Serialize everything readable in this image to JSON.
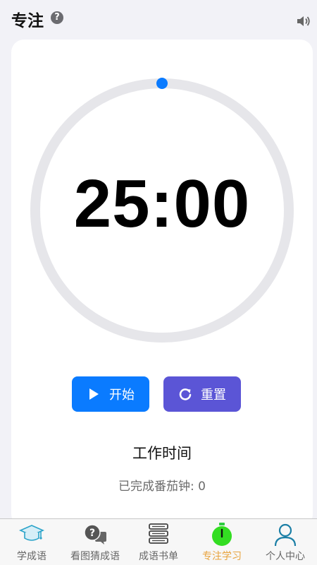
{
  "header": {
    "title": "专注",
    "help_glyph": "?",
    "icons": [
      "help-icon",
      "speaker-icon"
    ]
  },
  "timer": {
    "display": "25:00",
    "progress": 0,
    "ring_color": "#e6e6ea",
    "indicator_color": "#0a7bff"
  },
  "controls": {
    "start_label": "开始",
    "reset_label": "重置",
    "start_color": "#0a7bff",
    "reset_color": "#5b55d6"
  },
  "status": {
    "mode": "工作时间",
    "completed_text": "已完成番茄钟: 0"
  },
  "tabbar": {
    "items": [
      {
        "label": "学成语",
        "icon": "graduation-cap-icon",
        "active": false
      },
      {
        "label": "看图猜成语",
        "icon": "question-chat-icon",
        "active": false
      },
      {
        "label": "成语书单",
        "icon": "book-stack-icon",
        "active": false
      },
      {
        "label": "专注学习",
        "icon": "stopwatch-icon",
        "active": true
      },
      {
        "label": "个人中心",
        "icon": "user-icon",
        "active": false
      }
    ],
    "active_color": "#e8a33d"
  }
}
